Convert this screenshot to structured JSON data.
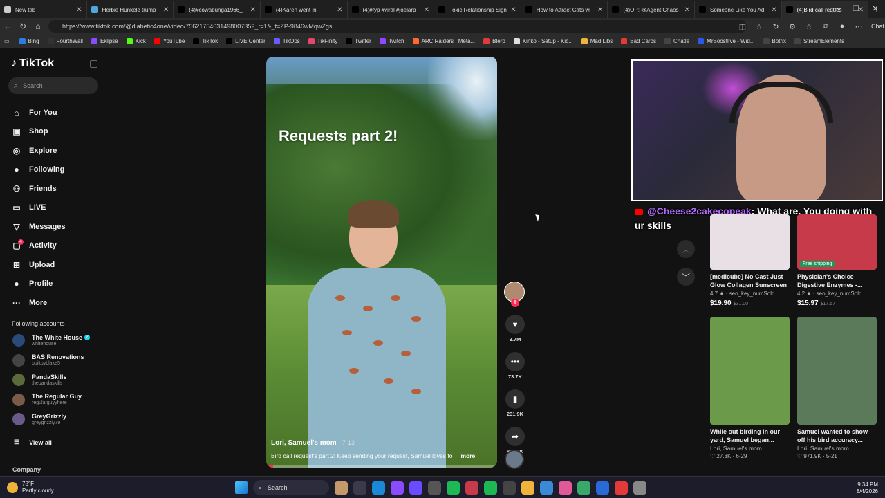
{
  "tabs": [
    {
      "title": "New tab",
      "color": "#ccc"
    },
    {
      "title": "Herbie Hunkele trump",
      "color": "#4ea8de"
    },
    {
      "title": "(4)#cowabunga1966_",
      "color": "#000"
    },
    {
      "title": "(4)Karen went in",
      "color": "#000"
    },
    {
      "title": "(4)#fyp #viral #joelarp",
      "color": "#000"
    },
    {
      "title": "Toxic Relationship Sign",
      "color": "#000"
    },
    {
      "title": "How to Attract Cats wi",
      "color": "#000"
    },
    {
      "title": "(4)OP: @Agent Chaos",
      "color": "#000"
    },
    {
      "title": "Someone Like You Ad",
      "color": "#000"
    },
    {
      "title": "(4)Bird call reques",
      "color": "#000",
      "active": true
    }
  ],
  "address": {
    "url": "https://www.tiktok.com/@diabetic4one/video/7562175463149800735?_r=1&_t=ZP-9846wMqwZgs",
    "chat_label": "Chat"
  },
  "bookmarks": [
    {
      "label": "Bing",
      "color": "#2a7de1"
    },
    {
      "label": "FourthWall",
      "color": "#333"
    },
    {
      "label": "Eklipse",
      "color": "#8a4bff"
    },
    {
      "label": "Kick",
      "color": "#53fc18"
    },
    {
      "label": "YouTube",
      "color": "#ff0000"
    },
    {
      "label": "TikTok",
      "color": "#000"
    },
    {
      "label": "LIVE Center",
      "color": "#000"
    },
    {
      "label": "TikOps",
      "color": "#6a5bff"
    },
    {
      "label": "TikFinity",
      "color": "#e9456a"
    },
    {
      "label": "Twitter",
      "color": "#000"
    },
    {
      "label": "Twitch",
      "color": "#9146ff"
    },
    {
      "label": "ARC Raiders | Meta...",
      "color": "#ff6a2a"
    },
    {
      "label": "Blerp",
      "color": "#e23a3a"
    },
    {
      "label": "Kinko - Setup - Kic...",
      "color": "#ddd"
    },
    {
      "label": "Mad Libs",
      "color": "#f2b33a"
    },
    {
      "label": "Bad Cards",
      "color": "#e23a3a"
    },
    {
      "label": "Chatle",
      "color": "#444"
    },
    {
      "label": "MrBoostlive - Wid...",
      "color": "#2a5ae1"
    },
    {
      "label": "Botrix",
      "color": "#444"
    },
    {
      "label": "StreamElements",
      "color": "#444"
    }
  ],
  "sidebar": {
    "logo": "TikTok",
    "search_placeholder": "Search",
    "nav": [
      {
        "label": "For You",
        "icon": "⌂"
      },
      {
        "label": "Shop",
        "icon": "▣"
      },
      {
        "label": "Explore",
        "icon": "◎"
      },
      {
        "label": "Following",
        "icon": "●"
      },
      {
        "label": "Friends",
        "icon": "⚇"
      },
      {
        "label": "LIVE",
        "icon": "▭"
      },
      {
        "label": "Messages",
        "icon": "▽"
      },
      {
        "label": "Activity",
        "icon": "▢",
        "badge": "4"
      },
      {
        "label": "Upload",
        "icon": "⊞"
      },
      {
        "label": "Profile",
        "icon": "●"
      },
      {
        "label": "More",
        "icon": "···"
      }
    ],
    "following_header": "Following accounts",
    "accounts": [
      {
        "name": "The White House",
        "handle": "whitehouse",
        "color": "#2a4a7a",
        "verified": true
      },
      {
        "name": "BAS Renovations",
        "handle": "builtbyblake5",
        "color": "#444"
      },
      {
        "name": "PandaSkills",
        "handle": "thepandaskills",
        "color": "#5a6a3a"
      },
      {
        "name": "The Regular Guy",
        "handle": "regularguyyhere",
        "color": "#7a5a4a"
      },
      {
        "name": "GreyGrizzly",
        "handle": "greygrizzly79",
        "color": "#6a5a8a"
      }
    ],
    "view_all": "View all",
    "company": "Company"
  },
  "video": {
    "overlay_title": "Requests part 2!",
    "author": "Lori, Samuel's mom",
    "date": "· 7-13",
    "description": "Bird call request's part 2! Keep sending your request, Samuel loves to",
    "more": "more",
    "progress": 0.03
  },
  "actions": {
    "likes": "3.7M",
    "comments": "73.7K",
    "saves": "231.9K",
    "shares": "893.8K"
  },
  "webcam_chat": {
    "user": "@Cheese2cakecopeak",
    "message": ": What are. You doing with ur skills"
  },
  "recommendations": [
    {
      "title": "[medicube] No Cast Just Glow Collagen Sunscreen ...",
      "rating": "4.7 ★ · seo_key_numSold",
      "price": "$19.90",
      "old_price": "$31.00",
      "thumb_color": "#e8e0e4",
      "kind": "product"
    },
    {
      "title": "Physician's Choice Digestive Enzymes -...",
      "rating": "4.2 ★ · seo_key_numSold",
      "price": "$15.97",
      "old_price": "$17.57",
      "thumb_color": "#c73a4a",
      "kind": "product",
      "badge": "Free shipping"
    },
    {
      "title": "While out birding in our yard, Samuel began...",
      "author": "Lori, Samuel's mom",
      "stats": "♡ 27.3K · 6-29",
      "thumb_color": "#6a9a4a",
      "kind": "video"
    },
    {
      "title": "Samuel wanted to show off his bird accuracy...",
      "author": "Lori, Samuel's mom",
      "stats": "♡ 971.9K · 5-21",
      "thumb_color": "#5a7a5a",
      "kind": "video"
    }
  ],
  "taskbar": {
    "temp": "78°F",
    "condition": "Partly cloudy",
    "search": "Search",
    "time": "9:34 PM",
    "date": "8/4/2026",
    "icons": [
      "#c49a6a",
      "#3a3a4a",
      "#1a8ad6",
      "#8a4bff",
      "#6a4bff",
      "#555",
      "#1db954",
      "#c73a4a",
      "#1db954",
      "#444",
      "#f2b33a",
      "#3a8ad6",
      "#e05a9a",
      "#3aa86a",
      "#2a6ad6",
      "#e23a3a",
      "#888"
    ]
  }
}
